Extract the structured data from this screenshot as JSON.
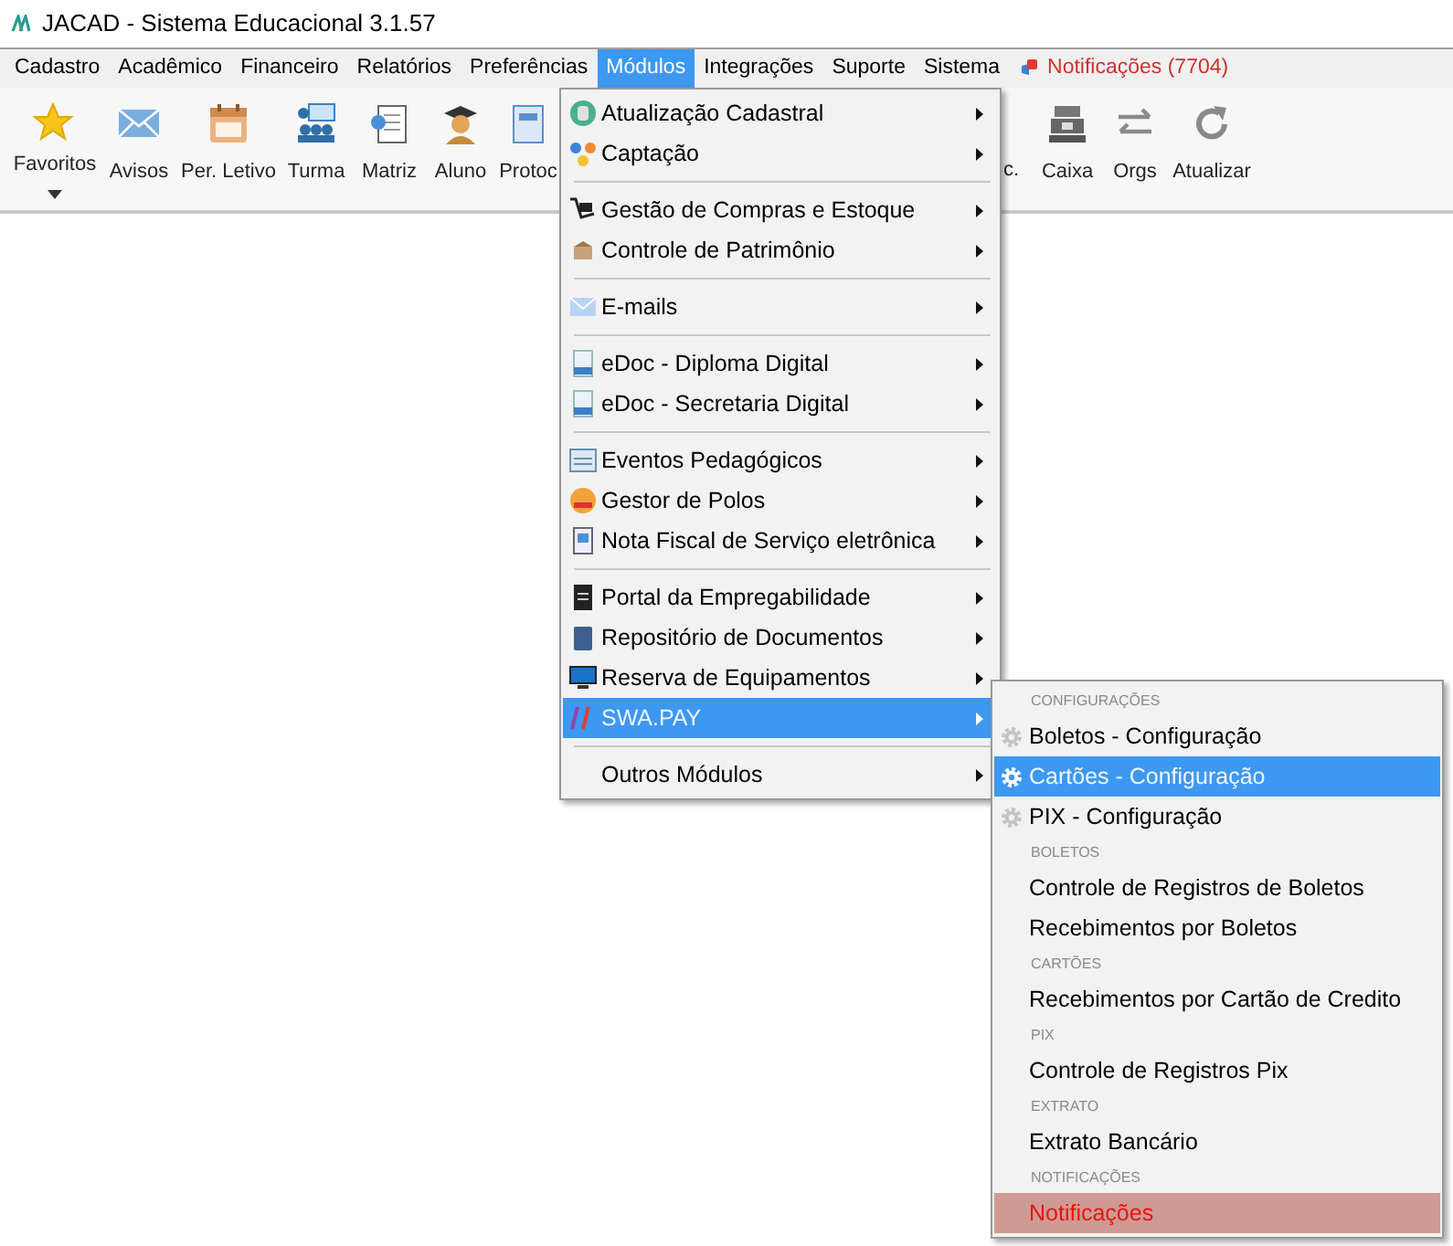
{
  "window": {
    "title": "JACAD - Sistema Educacional 3.1.57"
  },
  "menubar": [
    {
      "label": "Cadastro",
      "selected": false,
      "kind": "menu"
    },
    {
      "label": "Acadêmico",
      "selected": false,
      "kind": "menu"
    },
    {
      "label": "Financeiro",
      "selected": false,
      "kind": "menu"
    },
    {
      "label": "Relatórios",
      "selected": false,
      "kind": "menu"
    },
    {
      "label": "Preferências",
      "selected": false,
      "kind": "menu"
    },
    {
      "label": "Módulos",
      "selected": true,
      "kind": "menu"
    },
    {
      "label": "Integrações",
      "selected": false,
      "kind": "menu"
    },
    {
      "label": "Suporte",
      "selected": false,
      "kind": "menu"
    },
    {
      "label": "Sistema",
      "selected": false,
      "kind": "menu"
    },
    {
      "label": "Notificações (7704)",
      "kind": "notifications"
    }
  ],
  "toolbar_left": [
    {
      "label": "Favoritos",
      "kind": "dropdown"
    },
    {
      "label": "Avisos",
      "kind": "button"
    },
    {
      "label": "Per. Letivo",
      "kind": "button"
    },
    {
      "label": "Turma",
      "kind": "button"
    },
    {
      "label": "Matriz",
      "kind": "button"
    },
    {
      "label": "Aluno",
      "kind": "button"
    },
    {
      "label": "Protoc",
      "kind": "button"
    }
  ],
  "toolbar_right": [
    {
      "label": "c.",
      "kind": "button"
    },
    {
      "label": "Caixa",
      "kind": "button"
    },
    {
      "label": "Orgs",
      "kind": "button"
    },
    {
      "label": "Atualizar",
      "kind": "button"
    }
  ],
  "modules_menu": [
    {
      "kind": "item",
      "label": "Atualização Cadastral",
      "selected": false
    },
    {
      "kind": "item",
      "label": "Captação",
      "selected": false
    },
    {
      "kind": "separator"
    },
    {
      "kind": "item",
      "label": "Gestão de Compras e Estoque",
      "selected": false
    },
    {
      "kind": "item",
      "label": "Controle de Patrimônio",
      "selected": false
    },
    {
      "kind": "separator"
    },
    {
      "kind": "item",
      "label": "E-mails",
      "selected": false
    },
    {
      "kind": "separator"
    },
    {
      "kind": "item",
      "label": "eDoc - Diploma Digital",
      "selected": false
    },
    {
      "kind": "item",
      "label": "eDoc - Secretaria Digital",
      "selected": false
    },
    {
      "kind": "separator"
    },
    {
      "kind": "item",
      "label": "Eventos Pedagógicos",
      "selected": false
    },
    {
      "kind": "item",
      "label": "Gestor de Polos",
      "selected": false
    },
    {
      "kind": "item",
      "label": "Nota Fiscal de Serviço eletrônica",
      "selected": false
    },
    {
      "kind": "separator"
    },
    {
      "kind": "item",
      "label": "Portal da Empregabilidade",
      "selected": false
    },
    {
      "kind": "item",
      "label": "Repositório de Documentos",
      "selected": false
    },
    {
      "kind": "item",
      "label": "Reserva de Equipamentos",
      "selected": false
    },
    {
      "kind": "item",
      "label": "SWA.PAY",
      "selected": true
    },
    {
      "kind": "separator"
    },
    {
      "kind": "item",
      "label": "Outros Módulos",
      "selected": false
    }
  ],
  "swapay_menu": [
    {
      "kind": "header",
      "label": "CONFIGURAÇÕES"
    },
    {
      "kind": "item",
      "label": "Boletos - Configuração",
      "selected": false,
      "icon": true
    },
    {
      "kind": "item",
      "label": "Cartões - Configuração",
      "selected": true,
      "icon": true
    },
    {
      "kind": "item",
      "label": "PIX - Configuração",
      "selected": false,
      "icon": true
    },
    {
      "kind": "header",
      "label": "BOLETOS"
    },
    {
      "kind": "item",
      "label": "Controle de Registros de Boletos",
      "selected": false,
      "icon": false
    },
    {
      "kind": "item",
      "label": "Recebimentos por Boletos",
      "selected": false,
      "icon": false
    },
    {
      "kind": "header",
      "label": "CARTÕES"
    },
    {
      "kind": "item",
      "label": "Recebimentos por Cartão de Credito",
      "selected": false,
      "icon": false
    },
    {
      "kind": "header",
      "label": "PIX"
    },
    {
      "kind": "item",
      "label": "Controle de Registros Pix",
      "selected": false,
      "icon": false
    },
    {
      "kind": "header",
      "label": "EXTRATO"
    },
    {
      "kind": "item",
      "label": "Extrato Bancário",
      "selected": false,
      "icon": false
    },
    {
      "kind": "header",
      "label": "NOTIFICAÇÕES"
    },
    {
      "kind": "alert",
      "label": "Notificações",
      "selected": false,
      "icon": false
    }
  ]
}
